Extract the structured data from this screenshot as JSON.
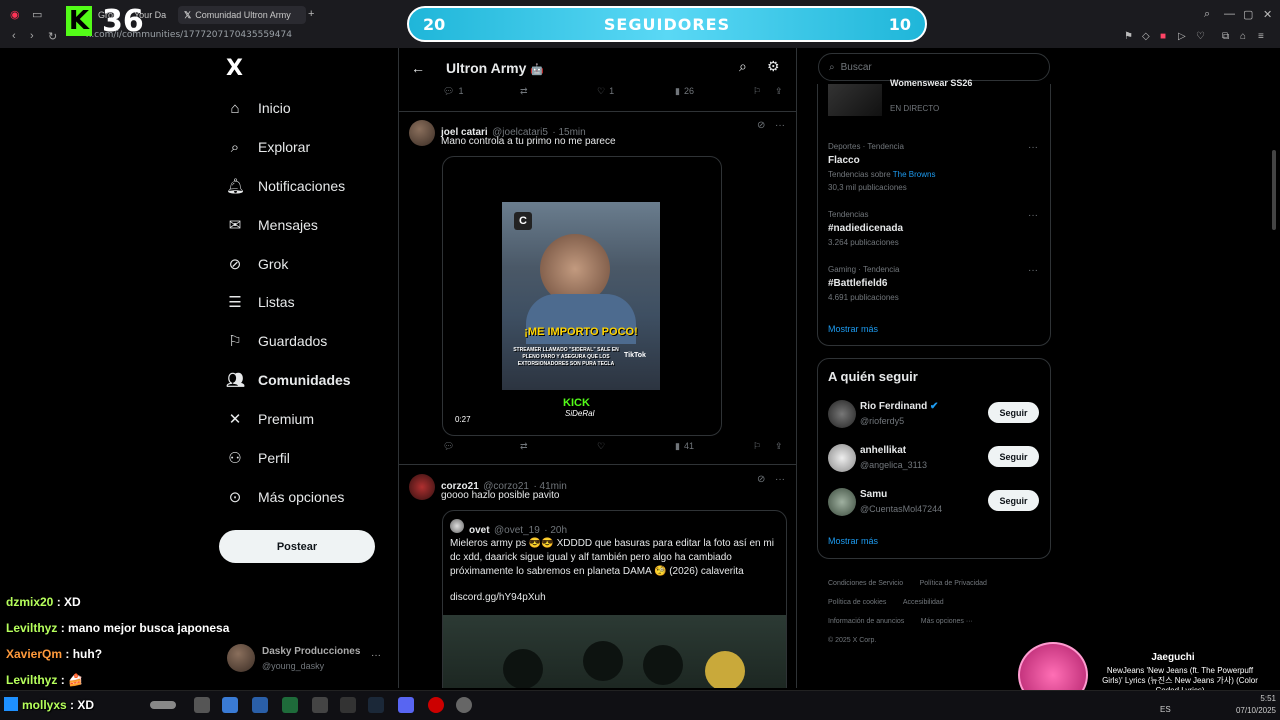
{
  "browser": {
    "tabs": [
      {
        "label": "Grok"
      },
      {
        "label": "Your Da"
      },
      {
        "label": "Comunidad Ultron Army"
      }
    ],
    "url": "x.com/i/communities/1777207170435559474"
  },
  "kick": {
    "logo": "K",
    "count": "36"
  },
  "goal": {
    "left": "20",
    "label": "SEGUIDORES",
    "right": "10"
  },
  "sidebar": {
    "logo": "X",
    "items": [
      {
        "icon": "home-icon",
        "label": "Inicio"
      },
      {
        "icon": "search-icon",
        "label": "Explorar"
      },
      {
        "icon": "bell-icon",
        "label": "Notificaciones"
      },
      {
        "icon": "mail-icon",
        "label": "Mensajes"
      },
      {
        "icon": "grok-icon",
        "label": "Grok"
      },
      {
        "icon": "list-icon",
        "label": "Listas"
      },
      {
        "icon": "bookmark-icon",
        "label": "Guardados"
      },
      {
        "icon": "communities-icon",
        "label": "Comunidades"
      },
      {
        "icon": "x-premium-icon",
        "label": "Premium"
      },
      {
        "icon": "profile-icon",
        "label": "Perfil"
      },
      {
        "icon": "more-icon",
        "label": "Más opciones"
      }
    ],
    "post_label": "Postear",
    "account": {
      "name": "Dasky Producciones",
      "handle": "@young_dasky"
    }
  },
  "header": {
    "title": "Ultron Army"
  },
  "top_actions": {
    "replies": "1",
    "likes": "1",
    "views": "26"
  },
  "tweets": [
    {
      "name": "joel catari",
      "handle": "@joelcatari5",
      "time": "· 15min",
      "text": "Mano controla a tu primo no me parece",
      "video": {
        "caption_main": "¡ME IMPORTO POCO!",
        "caption_sub": "STREAMER LLAMADO \"SIDERAL\" SALE EN PLENO PARO Y ASEGURA QUE LOS EXTORSIONADORES SON PURA TECLA",
        "watermark": "TikTok",
        "kick_label": "KICK",
        "kick_name": "SiDeRal",
        "duration": "0:27"
      },
      "views": "41"
    },
    {
      "name": "corzo21",
      "handle": "@corzo21",
      "time": "· 41min",
      "text": "goooo hazlo posible pavito",
      "quote": {
        "name": "ovet",
        "handle": "@ovet_19",
        "time": "· 20h",
        "text": "Mieleros army ps 😎😎 XDDDD que basuras para editar la foto así en mi dc xdd, daarick sigue igual y alf también pero algo ha cambiado próximamente lo sabremos en planeta DAMA 🧐 (2026) calaverita",
        "link": "discord.gg/hY94pXuh"
      }
    }
  ],
  "search": {
    "placeholder": "Buscar"
  },
  "live_trend": {
    "title": "Womenswear SS26",
    "status": "EN DIRECTO"
  },
  "trends": [
    {
      "meta": "Deportes · Tendencia",
      "name": "Flacco",
      "extra_prefix": "Tendencias sobre ",
      "extra_link": "The Browns",
      "count": "30,3 mil publicaciones"
    },
    {
      "meta": "Tendencias",
      "name": "#nadiedicenada",
      "count": "3.264 publicaciones"
    },
    {
      "meta": "Gaming · Tendencia",
      "name": "#Battlefield6",
      "count": "4.691 publicaciones"
    }
  ],
  "show_more": "Mostrar más",
  "who_to_follow": {
    "title": "A quién seguir",
    "button": "Seguir",
    "users": [
      {
        "name": "Rio Ferdinand",
        "handle": "@rioferdy5",
        "verified": true
      },
      {
        "name": "anhellikat",
        "handle": "@angelica_3113",
        "verified": false
      },
      {
        "name": "Samu",
        "handle": "@CuentasMol47244",
        "verified": false
      }
    ],
    "show_more": "Mostrar más"
  },
  "footer": {
    "links": [
      "Condiciones de Servicio",
      "Política de Privacidad",
      "Política de cookies",
      "Accesibilidad",
      "Información de anuncios",
      "Más opciones ···"
    ],
    "copyright": "© 2025 X Corp."
  },
  "chat": [
    {
      "user": "dzmix20",
      "msg": " : XD"
    },
    {
      "user": "Levilthyz",
      "msg": " : mano mejor busca japonesa"
    },
    {
      "user": "XavierQm",
      "msg": " : huh?"
    },
    {
      "user": "Levilthyz",
      "msg": " : 🍰"
    },
    {
      "user": "mollyxs",
      "msg": " : XD"
    }
  ],
  "music": {
    "artist": "Jaeguchi",
    "title": "NewJeans 'New Jeans (ft. The Powerpuff Girls)' Lyrics (뉴진스 New Jeans 가사) (Color Coded Lyrics)"
  },
  "taskbar": {
    "lang": "ES",
    "time": "5:51",
    "date": "07/10/2025"
  },
  "colors": {
    "accent": "#1d9bf0",
    "kick": "#53fc18",
    "goal": "#1fb6d9"
  }
}
